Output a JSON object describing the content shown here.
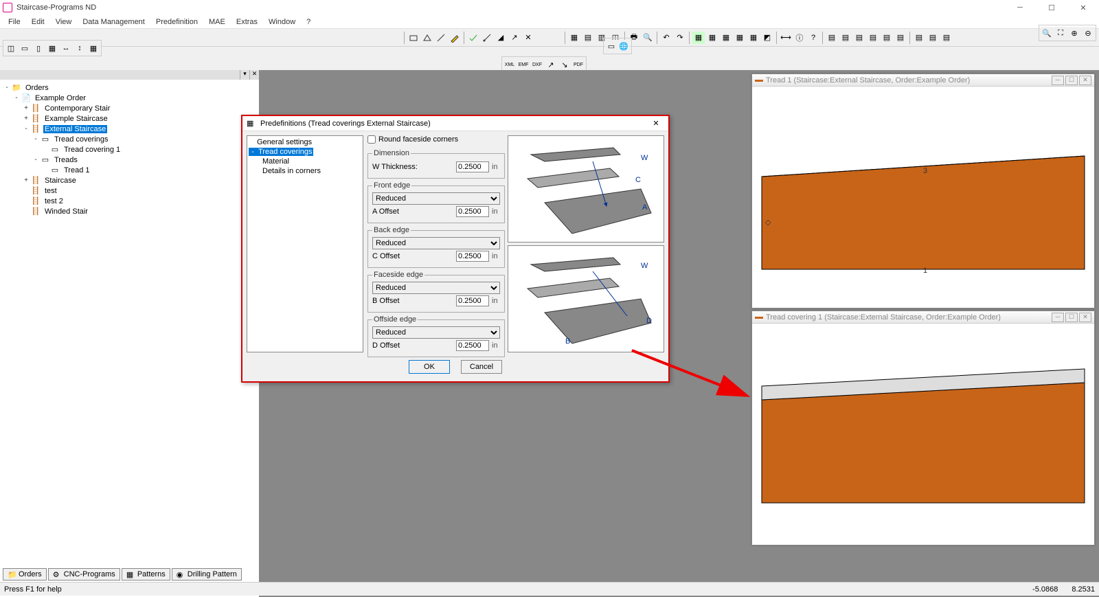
{
  "app": {
    "title": "Staircase-Programs ND"
  },
  "menu": [
    "File",
    "Edit",
    "View",
    "Data Management",
    "Predefinition",
    "MAE",
    "Extras",
    "Window",
    "?"
  ],
  "tree": {
    "root": "Orders",
    "items": [
      {
        "label": "Example Order",
        "depth": 1,
        "exp": "-"
      },
      {
        "label": "Contemporary Stair",
        "depth": 2,
        "exp": "+"
      },
      {
        "label": "Example Staircase",
        "depth": 2,
        "exp": "+"
      },
      {
        "label": "External Staircase",
        "depth": 2,
        "exp": "-",
        "selected": true
      },
      {
        "label": "Tread coverings",
        "depth": 3,
        "exp": "-"
      },
      {
        "label": "Tread covering  1",
        "depth": 4,
        "exp": ""
      },
      {
        "label": "Treads",
        "depth": 3,
        "exp": "-"
      },
      {
        "label": "Tread  1",
        "depth": 4,
        "exp": ""
      },
      {
        "label": "Staircase",
        "depth": 2,
        "exp": "+"
      },
      {
        "label": "test",
        "depth": 2,
        "exp": ""
      },
      {
        "label": "test 2",
        "depth": 2,
        "exp": ""
      },
      {
        "label": "Winded Stair",
        "depth": 2,
        "exp": ""
      }
    ]
  },
  "dialog": {
    "title": "Predefinitions (Tread coverings External Staircase)",
    "nav": {
      "general": "General settings",
      "selected": "Tread coverings",
      "material": "Material",
      "details": "Details in corners"
    },
    "round_corners": "Round faceside corners",
    "dimension": {
      "legend": "Dimension",
      "w_label": "W Thickness:",
      "w_val": "0.2500",
      "unit": "in"
    },
    "front": {
      "legend": "Front edge",
      "sel": "Reduced",
      "offset_label": "A Offset",
      "offset_val": "0.2500",
      "unit": "in"
    },
    "back": {
      "legend": "Back edge",
      "sel": "Reduced",
      "offset_label": "C Offset",
      "offset_val": "0.2500",
      "unit": "in"
    },
    "faceside": {
      "legend": "Faceside edge",
      "sel": "Reduced",
      "offset_label": "B Offset",
      "offset_val": "0.2500",
      "unit": "in"
    },
    "offside": {
      "legend": "Offside edge",
      "sel": "Reduced",
      "offset_label": "D Offset",
      "offset_val": "0.2500",
      "unit": "in"
    },
    "ok": "OK",
    "cancel": "Cancel"
  },
  "panels": {
    "top_title": "Tread 1 (Staircase:External Staircase, Order:Example Order)",
    "bottom_title": "Tread covering 1 (Staircase:External Staircase, Order:Example Order)"
  },
  "bottom_tabs": [
    "Orders",
    "CNC-Programs",
    "Patterns",
    "Drilling Pattern"
  ],
  "status": {
    "help": "Press  F1  for help",
    "x": "-5.0868",
    "y": "8.2531"
  }
}
